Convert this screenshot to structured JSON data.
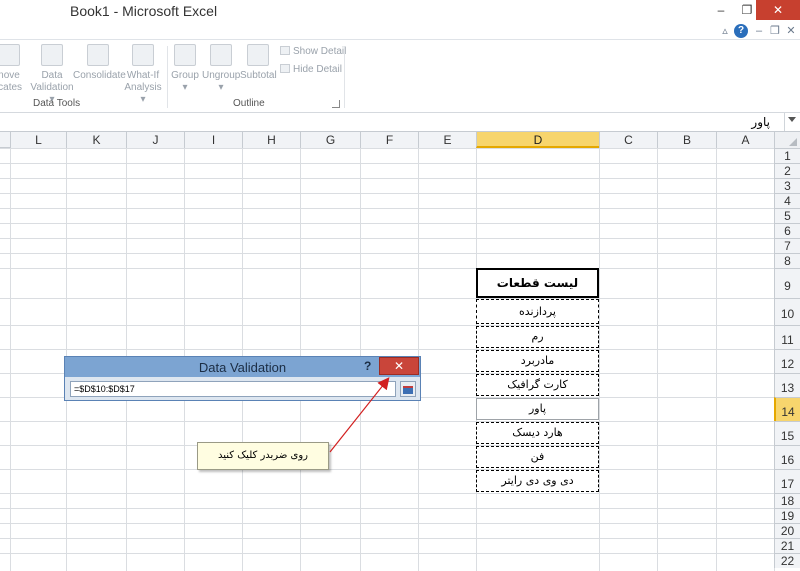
{
  "window": {
    "title": "Book1  -  Microsoft Excel",
    "minimize": "–",
    "restore": "❐",
    "close": "✕"
  },
  "ribbon": {
    "mini_buttons": [
      "▵",
      "?",
      "–",
      "❐",
      "✕"
    ],
    "buttons": [
      {
        "line1": "nove",
        "line2": "icates"
      },
      {
        "line1": "Data",
        "line2": "Validation ▾"
      },
      {
        "line1": "Consolidate",
        "line2": ""
      },
      {
        "line1": "What-If",
        "line2": "Analysis ▾"
      },
      {
        "line1": "Group",
        "line2": "▾"
      },
      {
        "line1": "Ungroup",
        "line2": "▾"
      },
      {
        "line1": "Subtotal",
        "line2": ""
      }
    ],
    "show_detail": "Show Detail",
    "hide_detail": "Hide Detail",
    "groups": [
      "Data Tools",
      "Outline"
    ]
  },
  "formula_bar": {
    "value": "پاور"
  },
  "columns": [
    "L",
    "K",
    "J",
    "I",
    "H",
    "G",
    "F",
    "E",
    "D",
    "C",
    "B",
    "A"
  ],
  "active_column": "D",
  "rows": [
    "1",
    "2",
    "3",
    "4",
    "5",
    "6",
    "7",
    "8",
    "9",
    "10",
    "11",
    "12",
    "13",
    "14",
    "15",
    "16",
    "17",
    "18",
    "19",
    "20",
    "21",
    "22"
  ],
  "active_row": "14",
  "list": {
    "header": "لیست قطعات",
    "items": [
      "پردازنده",
      "رم",
      "مادربرد",
      "کارت گرافیک",
      "پاور",
      "هارد دیسک",
      "فن",
      "دی وی دی رایتر"
    ]
  },
  "dialog": {
    "title": "Data Validation",
    "help": "?",
    "close": "✕",
    "input_value": "=$D$10:$D$17"
  },
  "callout": {
    "text": "روی ضربدر کلیک کنید"
  },
  "colors": {
    "accent_header": "#f7d56d",
    "dialog_title": "#7ca4d2",
    "dialog_close": "#c9453a",
    "annotation_arrow": "#d21f1f"
  }
}
